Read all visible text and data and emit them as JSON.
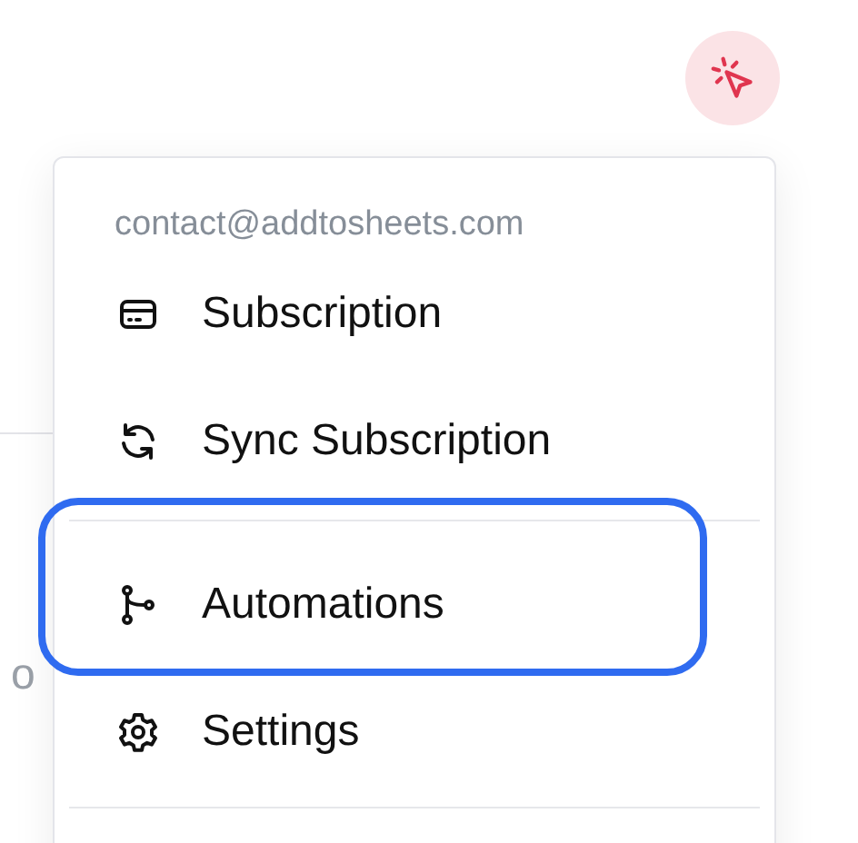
{
  "background": {
    "partial_text": "o"
  },
  "account_menu": {
    "email": "contact@addtosheets.com",
    "items": [
      {
        "kind": "subscription",
        "label": "Subscription",
        "highlighted": false,
        "divider_before": false
      },
      {
        "kind": "sync",
        "label": "Sync Subscription",
        "highlighted": false,
        "divider_before": false
      },
      {
        "kind": "automations",
        "label": "Automations",
        "highlighted": true,
        "divider_before": true
      },
      {
        "kind": "settings",
        "label": "Settings",
        "highlighted": false,
        "divider_before": false
      }
    ]
  }
}
